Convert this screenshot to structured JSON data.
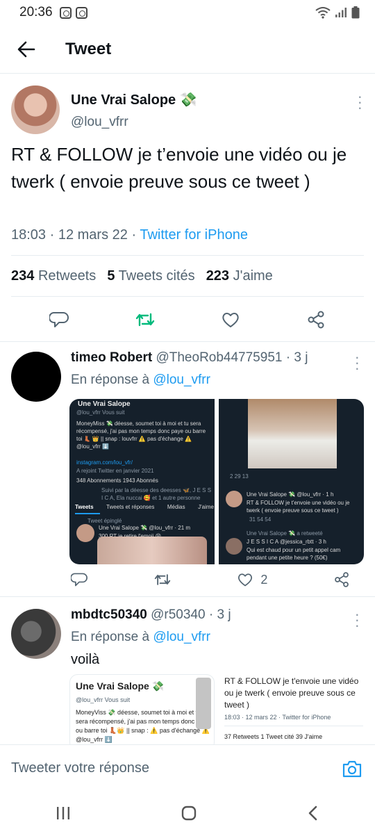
{
  "status_bar": {
    "time": "20:36"
  },
  "header": {
    "title": "Tweet"
  },
  "tweet": {
    "author_name": "Une Vrai Salope 💸",
    "author_handle": "@lou_vfrr",
    "text": "RT & FOLLOW je t’envoie une vidéo ou je twerk ( envoie preuve sous ce tweet )",
    "time": "18:03",
    "date": "12 mars 22",
    "source": "Twitter for iPhone",
    "stats": {
      "retweets_count": "234",
      "retweets_label": "Retweets",
      "quotes_count": "5",
      "quotes_label": "Tweets cités",
      "likes_count": "223",
      "likes_label": "J'aime"
    }
  },
  "replies": [
    {
      "author_name": "timeo Robert",
      "author_handle": "@TheoRob44775951",
      "time_ago": "3 j",
      "in_reply_label": "En réponse à",
      "in_reply_to": "@lou_vfrr",
      "likes": "2",
      "media_left": {
        "header": "Une Vrai Salope",
        "handle": "@lou_vfrr  Vous suit",
        "bio": "MoneyMiss 💸 déesse, soumet toi à moi et tu sera récompensé, j'ai pas mon temps donc paye ou barre toi 👢 👑 || snap : louvfrr ⚠️ pas d'échange ⚠️ @lou_vfrr ⬇️",
        "link": "instagram.com/lou_vfr/",
        "joined": "A rejoint Twitter en janvier 2021",
        "follows": "348 Abonnements   1943 Abonnés",
        "followed_by": "Suivi par la déesse des deesses 🦋, J E S S I C A, Ela nuccai 🥰 et 1 autre personne",
        "tabs": [
          "Tweets",
          "Tweets et réponses",
          "Médias",
          "J'aime"
        ],
        "pinned_label": "Tweet épinglé",
        "pinned_author": "Une Vrai Salope 💸 @lou_vfrr · 21 m",
        "pinned_text": "300 RT je retire l'emoji 😝"
      },
      "media_right": {
        "counts": "2      29      13",
        "quoted_author": "Une Vrai Salope 💸 @lou_vfrr · 1 h",
        "quoted_text": "RT & FOLLOW je t'envoie une vidéo ou je twerk ( envoie preuve sous ce tweet )",
        "quoted_counts": "31      54      54",
        "retweet_label": "Une Vrai Salope 💸 a retweeté",
        "rt_author": "J E S S I C A @jessica_rbtt · 3 h",
        "rt_text": "Qui est chaud pour un petit appel cam pendant une petite heure ? (50€)"
      }
    },
    {
      "author_name": "mbdtc50340",
      "author_handle": "@r50340",
      "time_ago": "3 j",
      "in_reply_label": "En réponse à",
      "in_reply_to": "@lou_vfrr",
      "text": "voilà",
      "quote_left": {
        "name": "Une Vrai Salope 💸",
        "handle": "@lou_vfrr  Vous suit",
        "bio": "MoneyViss 💸 déesse, soumet toi à moi et tu sera récompensé, j'ai pas mon temps donc paye ou barre toi 👢👑 || snap : ⚠️ pas d'échange ⚠️ @lou_vfrr ⬇️"
      },
      "quote_right": {
        "text": "RT & FOLLOW je t'envoie une vidéo ou je twerk ( envoie preuve sous ce tweet )",
        "meta": "18:03 · 12 mars 22 · Twitter for iPhone",
        "stats": "37 Retweets   1 Tweet cité   39 J'aime"
      }
    }
  ],
  "compose": {
    "placeholder": "Tweeter votre réponse"
  },
  "colors": {
    "accent": "#1d9bf0",
    "retweet_green": "#00ba7c",
    "text": "#0f1419",
    "muted": "#536471"
  }
}
